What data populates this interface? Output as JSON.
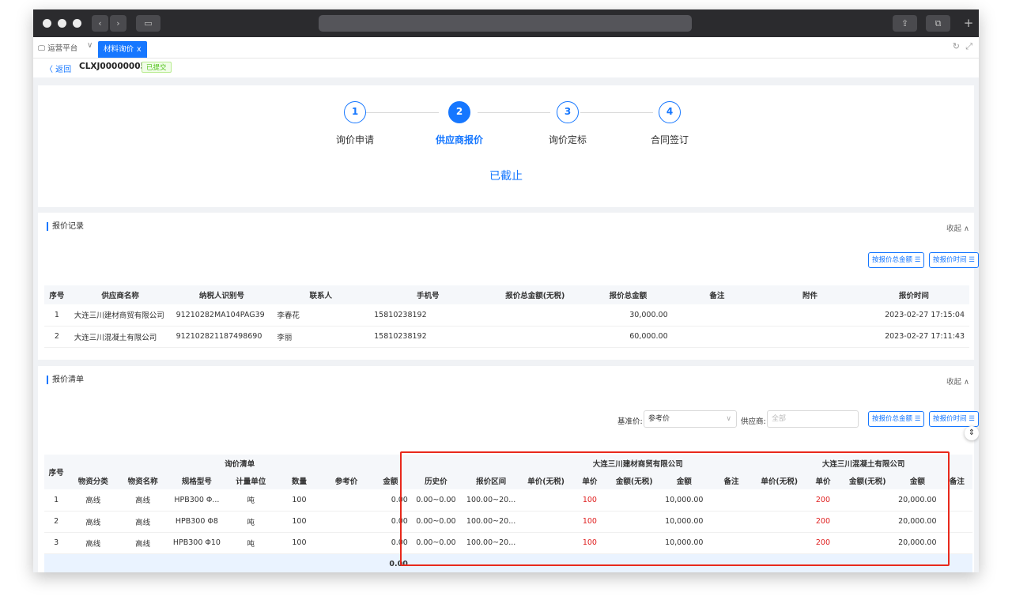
{
  "browser": {
    "back_icon": "chevron-left-icon",
    "forward_icon": "chevron-right-icon",
    "sidebar_icon": "sidebar-icon",
    "share_icon": "share-icon",
    "tabs_icon": "tabs-icon",
    "plus_label": "+"
  },
  "tabs": {
    "home_label": "运营平台",
    "active_label": "材料询价",
    "close_label": "x",
    "refresh_icon": "↻",
    "fullscreen_icon": "⤢"
  },
  "header": {
    "back_label": "〈 返回",
    "doc_no": "CLXJ00000005",
    "status": "已提交"
  },
  "steps": [
    {
      "num": "1",
      "label": "询价申请",
      "active": false
    },
    {
      "num": "2",
      "label": "供应商报价",
      "active": true
    },
    {
      "num": "3",
      "label": "询价定标",
      "active": false
    },
    {
      "num": "4",
      "label": "合同签订",
      "active": false
    }
  ],
  "status_text": "已截止",
  "quote_records": {
    "title": "报价记录",
    "collapse_label": "收起 ∧",
    "sort_amount_label": "按报价总金额 ☰",
    "sort_time_label": "按报价时间 ☰",
    "columns": [
      "序号",
      "供应商名称",
      "纳税人识别号",
      "联系人",
      "手机号",
      "报价总金额(无税)",
      "报价总金额",
      "备注",
      "附件",
      "报价时间"
    ],
    "rows": [
      [
        "1",
        "大连三川建材商贸有限公司",
        "91210282MA104PAG39",
        "李春花",
        "15810238192",
        "",
        "30,000.00",
        "",
        "",
        "2023-02-27 17:15:04"
      ],
      [
        "2",
        "大连三川混凝土有限公司",
        "912102821187498690",
        "李丽",
        "15810238192",
        "",
        "60,000.00",
        "",
        "",
        "2023-02-27 17:11:43"
      ]
    ]
  },
  "quote_list": {
    "title": "报价清单",
    "collapse_label": "收起 ∧",
    "base_price_label": "基准价:",
    "base_price_value": "参考价",
    "supplier_label": "供应商:",
    "supplier_placeholder": "全部",
    "sort_amount_label": "按报价总金额 ☰",
    "sort_time_label": "按报价时间 ☰",
    "group_headers": {
      "index": "序号",
      "inquiry": "询价清单",
      "supplier1": "大连三川建材商贸有限公司",
      "supplier2": "大连三川混凝土有限公司"
    },
    "columns": [
      "物资分类",
      "物资名称",
      "规格型号",
      "计量单位",
      "数量",
      "参考价",
      "金额",
      "历史价",
      "报价区间",
      "单价(无税)",
      "单价",
      "金额(无税)",
      "金额",
      "备注",
      "单价(无税)",
      "单价",
      "金额(无税)",
      "金额",
      "备注"
    ],
    "rows": [
      {
        "idx": "1",
        "category": "高线",
        "name": "高线",
        "spec": "HPB300 Φ...",
        "unit": "吨",
        "qty": "100",
        "ref": "",
        "amount": "0.00",
        "hist": "0.00~0.00",
        "range": "100.00~20...",
        "s1_unit_nt": "",
        "s1_unit": "100",
        "s1_amt_nt": "",
        "s1_amt": "10,000.00",
        "s1_note": "",
        "s2_unit_nt": "",
        "s2_unit": "200",
        "s2_amt_nt": "",
        "s2_amt": "20,000.00",
        "s2_note": ""
      },
      {
        "idx": "2",
        "category": "高线",
        "name": "高线",
        "spec": "HPB300 Φ8",
        "unit": "吨",
        "qty": "100",
        "ref": "",
        "amount": "0.00",
        "hist": "0.00~0.00",
        "range": "100.00~20...",
        "s1_unit_nt": "",
        "s1_unit": "100",
        "s1_amt_nt": "",
        "s1_amt": "10,000.00",
        "s1_note": "",
        "s2_unit_nt": "",
        "s2_unit": "200",
        "s2_amt_nt": "",
        "s2_amt": "20,000.00",
        "s2_note": ""
      },
      {
        "idx": "3",
        "category": "高线",
        "name": "高线",
        "spec": "HPB300 Φ10",
        "unit": "吨",
        "qty": "100",
        "ref": "",
        "amount": "0.00",
        "hist": "0.00~0.00",
        "range": "100.00~20...",
        "s1_unit_nt": "",
        "s1_unit": "100",
        "s1_amt_nt": "",
        "s1_amt": "10,000.00",
        "s1_note": "",
        "s2_unit_nt": "",
        "s2_unit": "200",
        "s2_amt_nt": "",
        "s2_amt": "20,000.00",
        "s2_note": ""
      }
    ],
    "total_amount": "0.00"
  },
  "colors": {
    "accent": "#1677ff",
    "highlight_box": "#e8291c",
    "price_red": "#e02020",
    "status_green": "#52c41a"
  }
}
